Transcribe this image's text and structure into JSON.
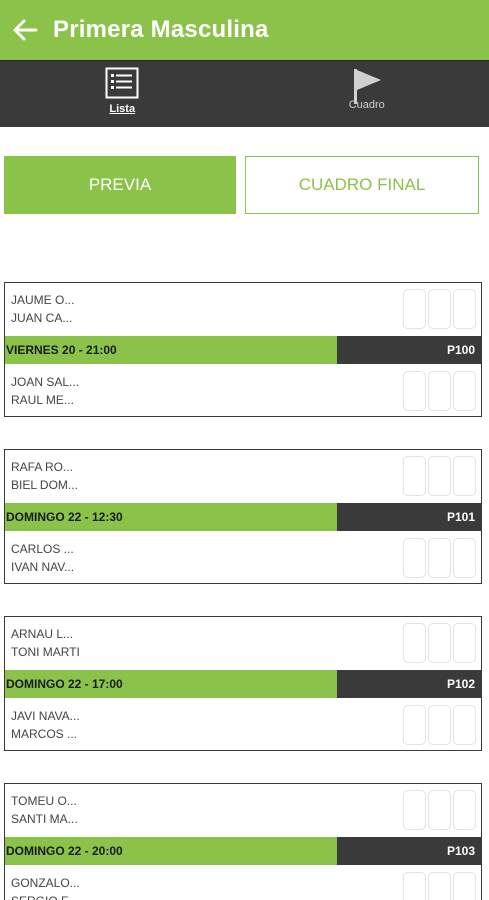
{
  "header": {
    "title": "Primera Masculina"
  },
  "tabs": [
    {
      "label": "Lista",
      "icon": "list-icon"
    },
    {
      "label": "Cuadro",
      "icon": "flag-icon"
    }
  ],
  "segments": {
    "left": "PREVIA",
    "right": "CUADRO FINAL"
  },
  "colors": {
    "accent": "#8bc34a",
    "dark": "#3a3a3a"
  },
  "matches": [
    {
      "team1": [
        "JAUME O...",
        "JUAN CA..."
      ],
      "when": "VIERNES 20 - 21:00",
      "code": "P100",
      "team2": [
        "JOAN SAL...",
        "RAUL ME..."
      ]
    },
    {
      "team1": [
        "RAFA RO...",
        "BIEL DOM..."
      ],
      "when": "DOMINGO 22 - 12:30",
      "code": "P101",
      "team2": [
        "CARLOS ...",
        "IVAN NAV..."
      ]
    },
    {
      "team1": [
        "ARNAU L...",
        "TONI MARTI"
      ],
      "when": "DOMINGO 22 - 17:00",
      "code": "P102",
      "team2": [
        "JAVI NAVA...",
        "MARCOS ..."
      ]
    },
    {
      "team1": [
        "TOMEU O...",
        "SANTI MA..."
      ],
      "when": "DOMINGO 22 - 20:00",
      "code": "P103",
      "team2": [
        "GONZALO...",
        "SERGIO F..."
      ]
    }
  ]
}
